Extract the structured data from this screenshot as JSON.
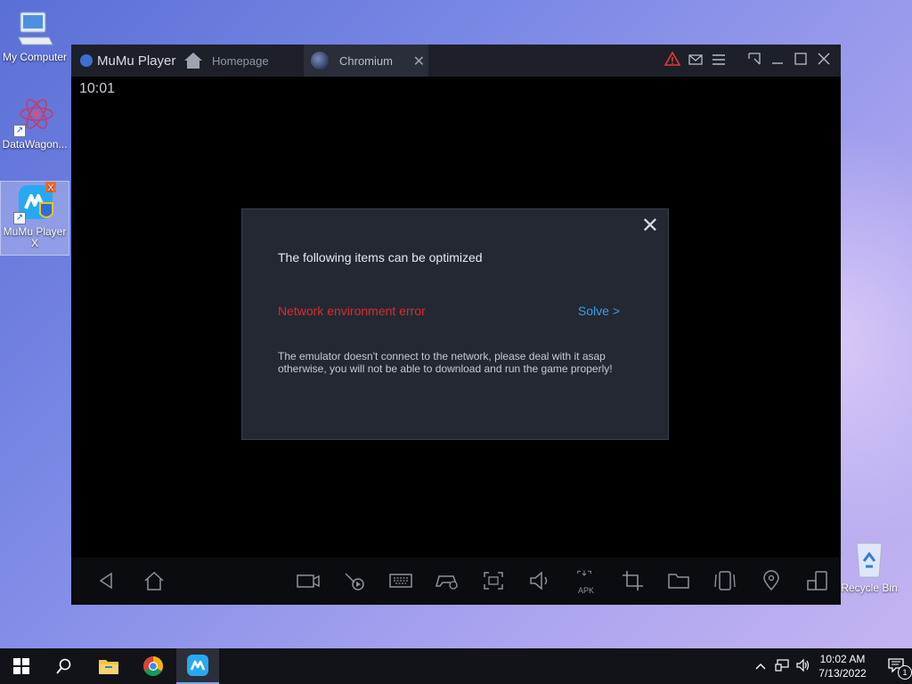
{
  "desktop": {
    "icons": [
      {
        "label": "My Computer"
      },
      {
        "label": "DataWagon..."
      },
      {
        "label": "MuMu Player X"
      },
      {
        "label": "Recycle Bin"
      }
    ]
  },
  "window": {
    "brand": "MuMu Player",
    "tabs": [
      {
        "label": "Homepage"
      },
      {
        "label": "Chromium",
        "close": "✕"
      }
    ],
    "time": "10:01",
    "dialog": {
      "close": "✕",
      "title": "The following items can be optimized",
      "error": "Network environment error",
      "solve": "Solve >",
      "message": "The emulator doesn't connect to the network, please deal with it asap otherwise, you will not be able to download and run the game properly!"
    },
    "toolbar": {
      "apk_label": "APK"
    }
  },
  "taskbar": {
    "time": "10:02 AM",
    "date": "7/13/2022",
    "notification_count": "1"
  },
  "colors": {
    "error": "#d72d2d",
    "link": "#3a9ee6",
    "warning": "#e03b3b"
  }
}
